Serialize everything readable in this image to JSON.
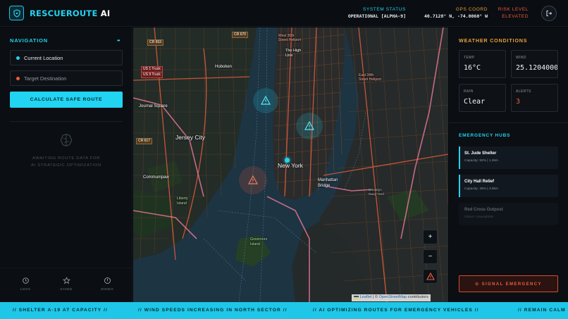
{
  "header": {
    "brand_part1": "RESCUEROUTE",
    "brand_part2": "AI",
    "system_status_label": "SYSTEM STATUS",
    "system_status_value": "OPERATIONAL [ALPHA-9]",
    "gps_label": "GPS COORD",
    "gps_value": "40.7128° N, -74.0060° W",
    "risk_label": "RISK LEVEL",
    "risk_value": "ELEVATED",
    "icons": {
      "logo": "shield-icon",
      "exit": "logout-icon"
    }
  },
  "navigation": {
    "title": "NAVIGATION",
    "dots": "••",
    "current_location_placeholder": "Current Location",
    "target_destination_placeholder": "Target Destination",
    "calculate_label": "CALCULATE SAFE ROUTE",
    "awaiting_line1": "AWAITING ROUTE DATA FOR",
    "awaiting_line2": "AI STRATEGIC OPTIMIZATION"
  },
  "footer_nav": [
    {
      "label": "LOGS",
      "icon": "history-icon"
    },
    {
      "label": "SAVED",
      "icon": "star-icon"
    },
    {
      "label": "ZONES",
      "icon": "compass-icon"
    }
  ],
  "map": {
    "labels": {
      "hoboken": "Hoboken",
      "jersey_city": "Jersey City",
      "journal_square": "Journal Square",
      "communipaw": "Communipaw",
      "new_york": "New York",
      "manhattan_bridge": "Manhattan Bridge",
      "high_line": "The High Line",
      "liberty_island": "Liberty Island",
      "governors_island": "Governors Island",
      "brooklyn_navy_yard": "Brooklyn Navy Yard",
      "heliport_1": "West 30th Street Heliport",
      "heliport_2": "East 34th Street Heliport",
      "truck_1": "US 1 Truck",
      "truck_2": "US 9 Truck",
      "cr653": "CR 653",
      "cr670": "CR 670",
      "cr617": "CR 617"
    },
    "zoom_in": "+",
    "zoom_out": "−",
    "attribution_leaflet": "Leaflet",
    "attribution_sep": " | © ",
    "attribution_osm": "OpenStreetMap",
    "attribution_rest": " contributors"
  },
  "weather": {
    "title": "WEATHER CONDITIONS",
    "temp_label": "TEMP",
    "temp_value": "16°C",
    "wind_label": "WIND",
    "wind_value": "25.1204000000",
    "rain_label": "RAIN",
    "rain_value": "Clear",
    "alerts_label": "ALERTS",
    "alerts_value": "3"
  },
  "hubs": {
    "title": "EMERGENCY HUBS",
    "items": [
      {
        "name": "St. Jude Shelter",
        "capacity": "Capacity: 82% | 1.2km"
      },
      {
        "name": "City Hall Relief",
        "capacity": "Capacity: 45% | 3.5km"
      },
      {
        "name": "Red Cross Outpost",
        "capacity": "Status: Unavailable"
      }
    ]
  },
  "signal_label": "⊙ SIGNAL EMERGENCY",
  "ticker": [
    "// SHELTER A-19 AT CAPACITY //",
    "// WIND SPEEDS INCREASING IN NORTH SECTOR //",
    "// AI OPTIMIZING ROUTES FOR EMERGENCY VEHICLES //",
    "// REMAIN CALM"
  ],
  "colors": {
    "accent": "#22d3ee",
    "alert": "#f15b3e",
    "warning": "#e8a13a",
    "background": "#07090d"
  }
}
